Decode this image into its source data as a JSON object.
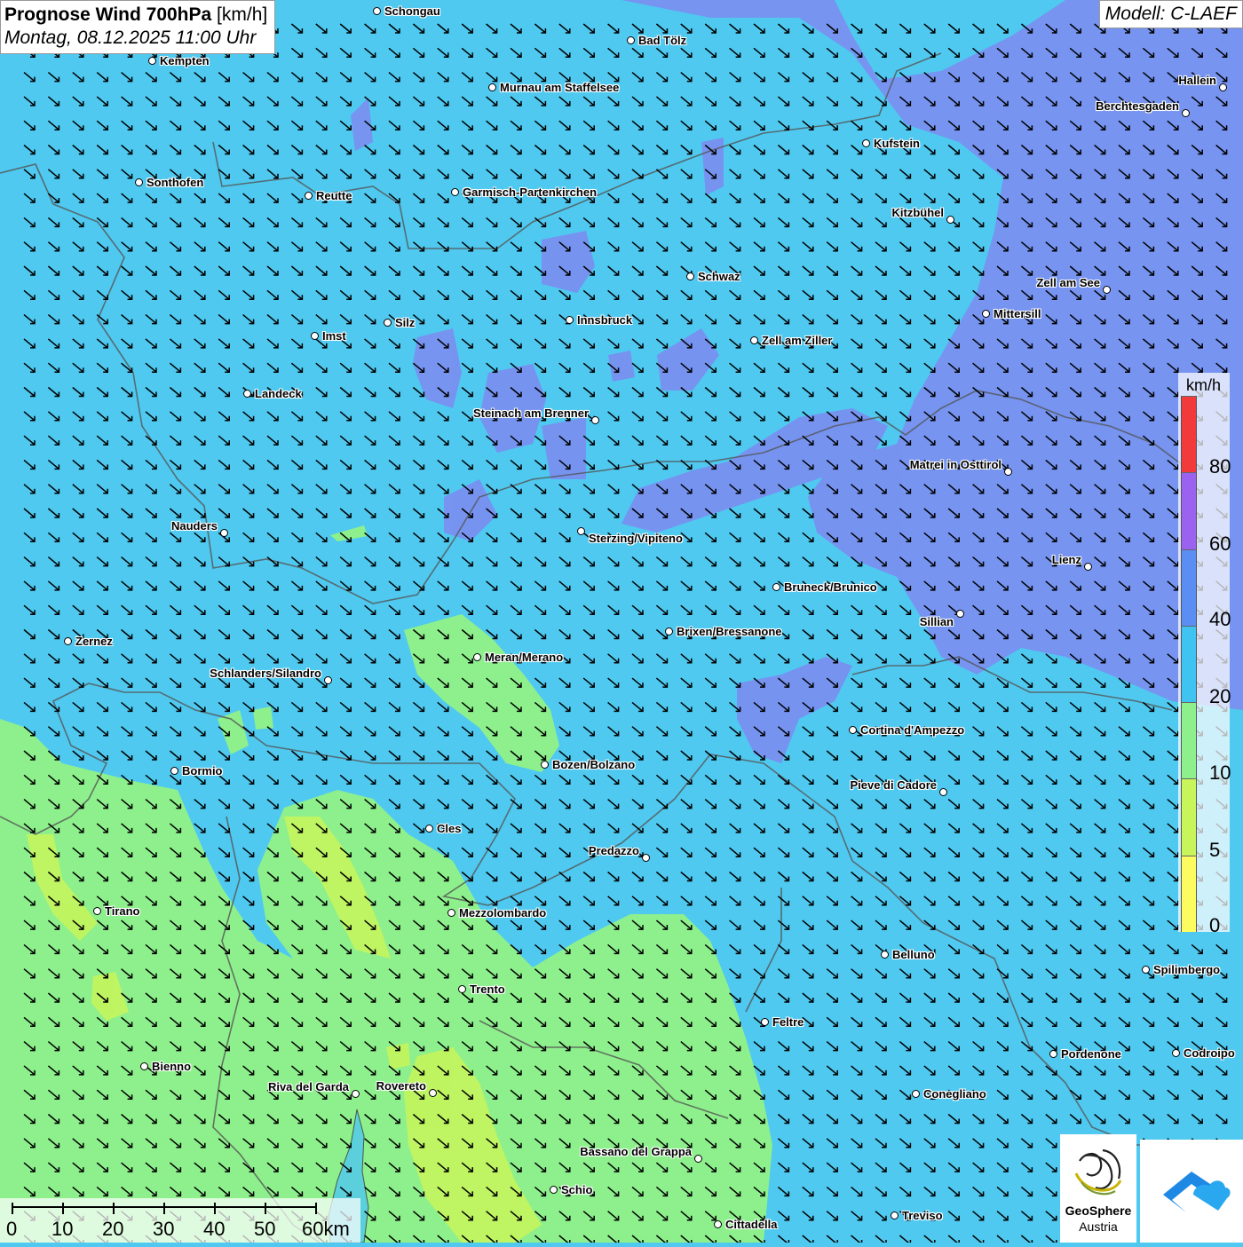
{
  "title": {
    "main": "Prognose Wind 700hPa",
    "unit": "[km/h]",
    "date": "Montag, 08.12.2025 11:00 Uhr"
  },
  "model": "Modell: C-LAEF",
  "legend": {
    "unit": "km/h",
    "classes": [
      {
        "label": "0",
        "color": "#fcfc60"
      },
      {
        "label": "5",
        "color": "#c8f55a"
      },
      {
        "label": "10",
        "color": "#8ef08c"
      },
      {
        "label": "20",
        "color": "#3fc3f0"
      },
      {
        "label": "40",
        "color": "#5b8ef2"
      },
      {
        "label": "60",
        "color": "#9b62f0"
      },
      {
        "label": "80",
        "color": "#f23a3a"
      }
    ]
  },
  "scalebar": {
    "labels": [
      "0",
      "10",
      "20",
      "30",
      "40",
      "50",
      "60km"
    ]
  },
  "logos": {
    "geosphere_line1": "GeoSphere",
    "geosphere_line2": "Austria"
  },
  "wind": {
    "direction": "northwesterly",
    "arrow_color": "#000000"
  },
  "colors": {
    "background_20_40": "#4fc9f0",
    "area_40_60": "#7a8ff0",
    "area_10_20": "#8ef08c",
    "area_5_10": "#c8f55a"
  },
  "cities": [
    {
      "name": "Schongau"
    },
    {
      "name": "Bad Tölz"
    },
    {
      "name": "Kempten"
    },
    {
      "name": "Murnau am Staffelsee"
    },
    {
      "name": "Hallein"
    },
    {
      "name": "Berchtesgaden"
    },
    {
      "name": "Kufstein"
    },
    {
      "name": "Sonthofen"
    },
    {
      "name": "Reutte"
    },
    {
      "name": "Garmisch-Partenkirchen"
    },
    {
      "name": "Kitzbühel"
    },
    {
      "name": "Schwaz"
    },
    {
      "name": "Zell am See"
    },
    {
      "name": "Mittersill"
    },
    {
      "name": "Innsbruck"
    },
    {
      "name": "Silz"
    },
    {
      "name": "Imst"
    },
    {
      "name": "Zell am Ziller"
    },
    {
      "name": "Landeck"
    },
    {
      "name": "Steinach am Brenner"
    },
    {
      "name": "Matrei in Osttirol"
    },
    {
      "name": "Nauders"
    },
    {
      "name": "Sterzing/Vipiteno"
    },
    {
      "name": "Lienz"
    },
    {
      "name": "Bruneck/Brunico"
    },
    {
      "name": "Sillian"
    },
    {
      "name": "Brixen/Bressanone"
    },
    {
      "name": "Zernez"
    },
    {
      "name": "Meran/Merano"
    },
    {
      "name": "Schlanders/Silandro"
    },
    {
      "name": "Cortina d'Ampezzo"
    },
    {
      "name": "Bozen/Bolzano"
    },
    {
      "name": "Bormio"
    },
    {
      "name": "Pieve di Cadore"
    },
    {
      "name": "Cles"
    },
    {
      "name": "Predazzo"
    },
    {
      "name": "Tirano"
    },
    {
      "name": "Mezzolombardo"
    },
    {
      "name": "Belluno"
    },
    {
      "name": "Spilimbergo"
    },
    {
      "name": "Trento"
    },
    {
      "name": "Feltre"
    },
    {
      "name": "Bienno"
    },
    {
      "name": "Pordenone"
    },
    {
      "name": "Codroipo"
    },
    {
      "name": "Riva del Garda"
    },
    {
      "name": "Rovereto"
    },
    {
      "name": "Conegliano"
    },
    {
      "name": "Bassano del Grappa"
    },
    {
      "name": "Schio"
    },
    {
      "name": "Treviso"
    },
    {
      "name": "Cittadella"
    }
  ]
}
